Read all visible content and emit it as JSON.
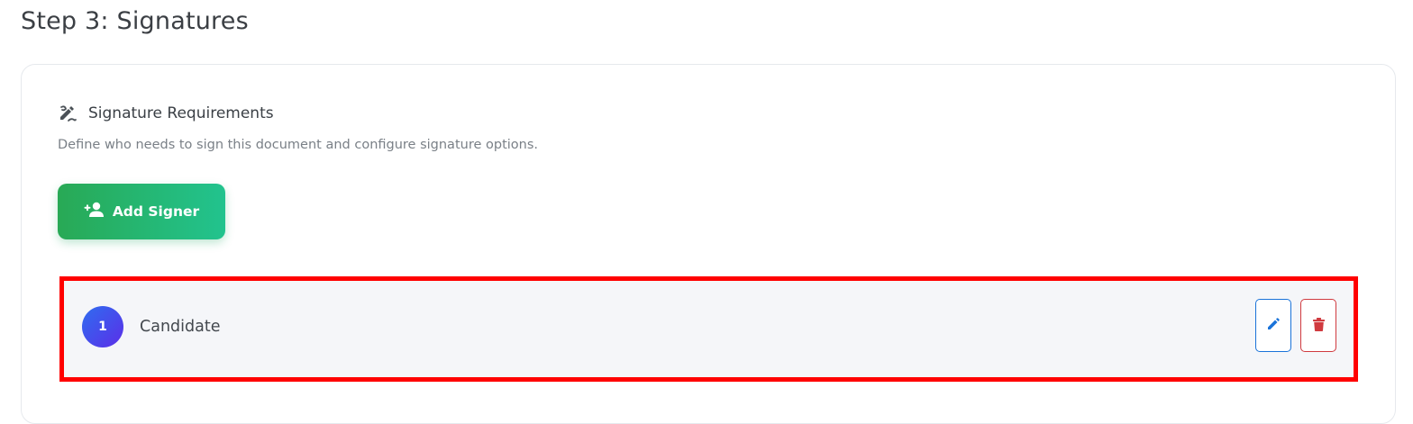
{
  "page": {
    "title": "Step 3: Signatures"
  },
  "section": {
    "icon": "signature-pen-icon",
    "title": "Signature Requirements",
    "description": "Define who needs to sign this document and configure signature options."
  },
  "add_signer_button": {
    "icon": "user-plus-icon",
    "label": "Add Signer"
  },
  "signers": [
    {
      "number": "1",
      "name": "Candidate",
      "actions": [
        {
          "icon": "pencil-icon",
          "color": "#1a73d9"
        },
        {
          "icon": "trash-icon",
          "color": "#d03a3f"
        }
      ]
    }
  ],
  "colors": {
    "add_button_start": "#28a955",
    "add_button_end": "#22c38e",
    "badge_start": "#2f6df0",
    "badge_end": "#5b2ee8",
    "highlight_border": "#ff0000",
    "row_background": "#f5f6f9"
  }
}
